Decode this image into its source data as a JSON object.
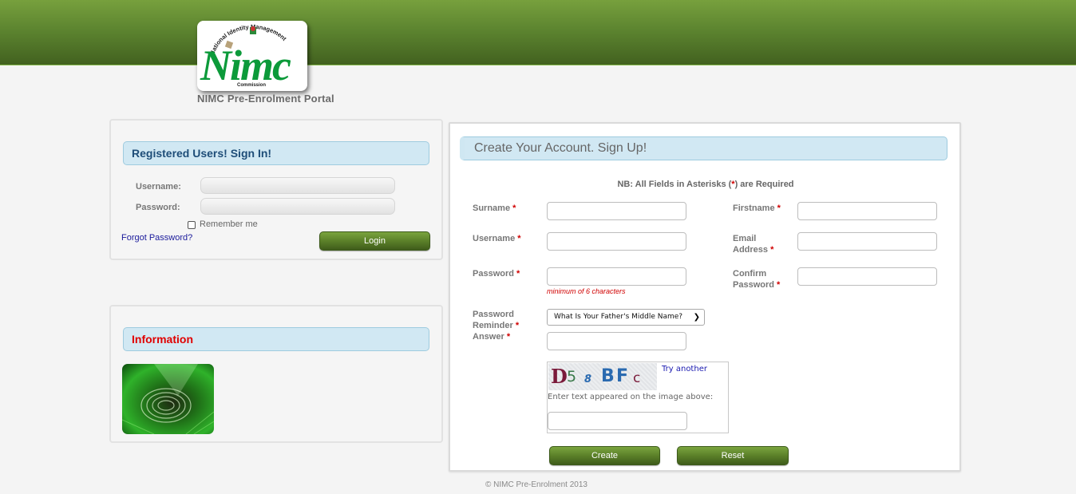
{
  "header": {
    "logo": {
      "text": "Nimc",
      "arc_top": "National Identity Management",
      "arc_bottom": "Commission"
    },
    "portal_title": "NIMC Pre-Enrolment Portal",
    "colors": {
      "brand_green": "#5d8530",
      "logo_green": "#0c9a3a"
    }
  },
  "login": {
    "title": "Registered Users! Sign In!",
    "username_label": "Username:",
    "username_value": "",
    "password_label": "Password:",
    "password_value": "",
    "remember_label": "Remember me",
    "remember_checked": false,
    "forgot_label": "Forgot Password?",
    "login_button": "Login"
  },
  "information": {
    "title": "Information",
    "image_icon": "fingerprint-icon"
  },
  "signup": {
    "title": "Create Your Account. Sign Up!",
    "note_prefix": "NB: All Fields in Asterisks (",
    "note_star": "*",
    "note_suffix": ") are Required",
    "required_mark": "*",
    "fields": {
      "surname": {
        "label": "Surname",
        "value": ""
      },
      "firstname": {
        "label": "Firstname",
        "value": ""
      },
      "username": {
        "label": "Username",
        "value": ""
      },
      "email_line1": "Email",
      "email_line2": "Address",
      "email_value": "",
      "password": {
        "label": "Password",
        "value": "",
        "hint": "minimum of 6 characters"
      },
      "confirm_line1": "Confirm",
      "confirm_line2": "Password",
      "confirm_value": "",
      "reminder_line1": "Password",
      "reminder_line2": "Reminder",
      "reminder_selected": "What Is Your Father's Middle Name?",
      "answer": {
        "label": "Answer",
        "value": ""
      }
    },
    "captcha": {
      "chars": [
        "D",
        "5",
        "8",
        "B",
        "F",
        "c"
      ],
      "try_another": "Try another",
      "instruction": "Enter text appeared on the image above:",
      "value": ""
    },
    "create_button": "Create",
    "reset_button": "Reset"
  },
  "footer": {
    "text": "© NIMC Pre-Enrolment 2013"
  }
}
